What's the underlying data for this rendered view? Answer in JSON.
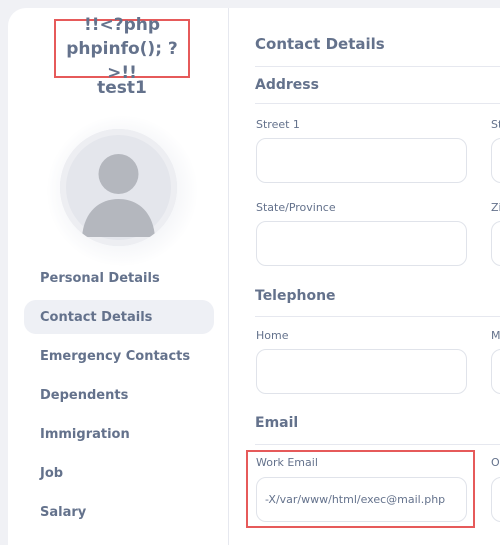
{
  "employee": {
    "name_line1": "!!<?php",
    "name_line2": "phpinfo(); ?>!!",
    "name_line3": "test1"
  },
  "menu": {
    "items": [
      {
        "label": "Personal Details",
        "active": false
      },
      {
        "label": "Contact Details",
        "active": true
      },
      {
        "label": "Emergency Contacts",
        "active": false
      },
      {
        "label": "Dependents",
        "active": false
      },
      {
        "label": "Immigration",
        "active": false
      },
      {
        "label": "Job",
        "active": false
      },
      {
        "label": "Salary",
        "active": false
      }
    ]
  },
  "content": {
    "title": "Contact Details",
    "address": {
      "heading": "Address",
      "street1_label": "Street 1",
      "street1_value": "",
      "street2_label_partial": "St",
      "state_label": "State/Province",
      "state_value": "",
      "zip_label_partial": "Zi"
    },
    "telephone": {
      "heading": "Telephone",
      "home_label": "Home",
      "home_value": "",
      "mobile_label_partial": "M"
    },
    "email": {
      "heading": "Email",
      "work_label": "Work Email",
      "work_value": "-X/var/www/html/exec@mail.php",
      "other_label_partial": "O"
    }
  },
  "colors": {
    "text": "#64728c",
    "highlight_border": "#e65a5a",
    "page_bg": "#f0f1f5",
    "panel_bg": "#ffffff",
    "active_menu_bg": "#eef0f5"
  }
}
